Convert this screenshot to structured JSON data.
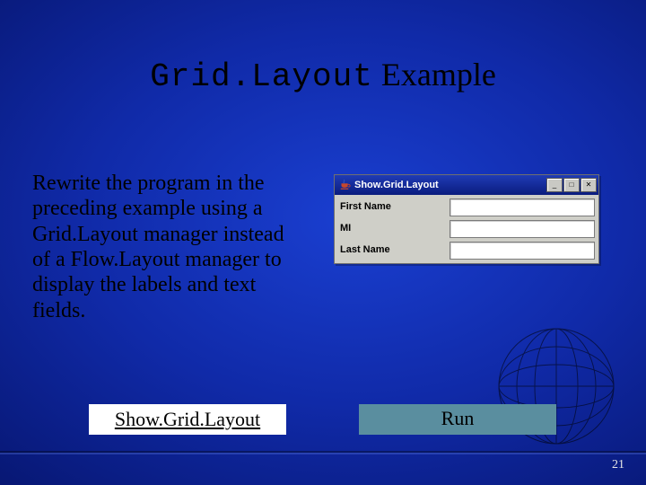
{
  "title": {
    "code": "Grid.Layout",
    "rest": " Example"
  },
  "body_text": "Rewrite the program in the preceding example using a Grid.Layout manager instead of a Flow.Layout manager to display the labels and text fields.",
  "link_label": "Show.Grid.Layout",
  "run_label": "Run",
  "page_number": "21",
  "java_window": {
    "title": "Show.Grid.Layout",
    "rows": [
      {
        "label": "First Name"
      },
      {
        "label": "MI"
      },
      {
        "label": "Last Name"
      }
    ],
    "btn_min": "_",
    "btn_max": "□",
    "btn_close": "✕"
  }
}
